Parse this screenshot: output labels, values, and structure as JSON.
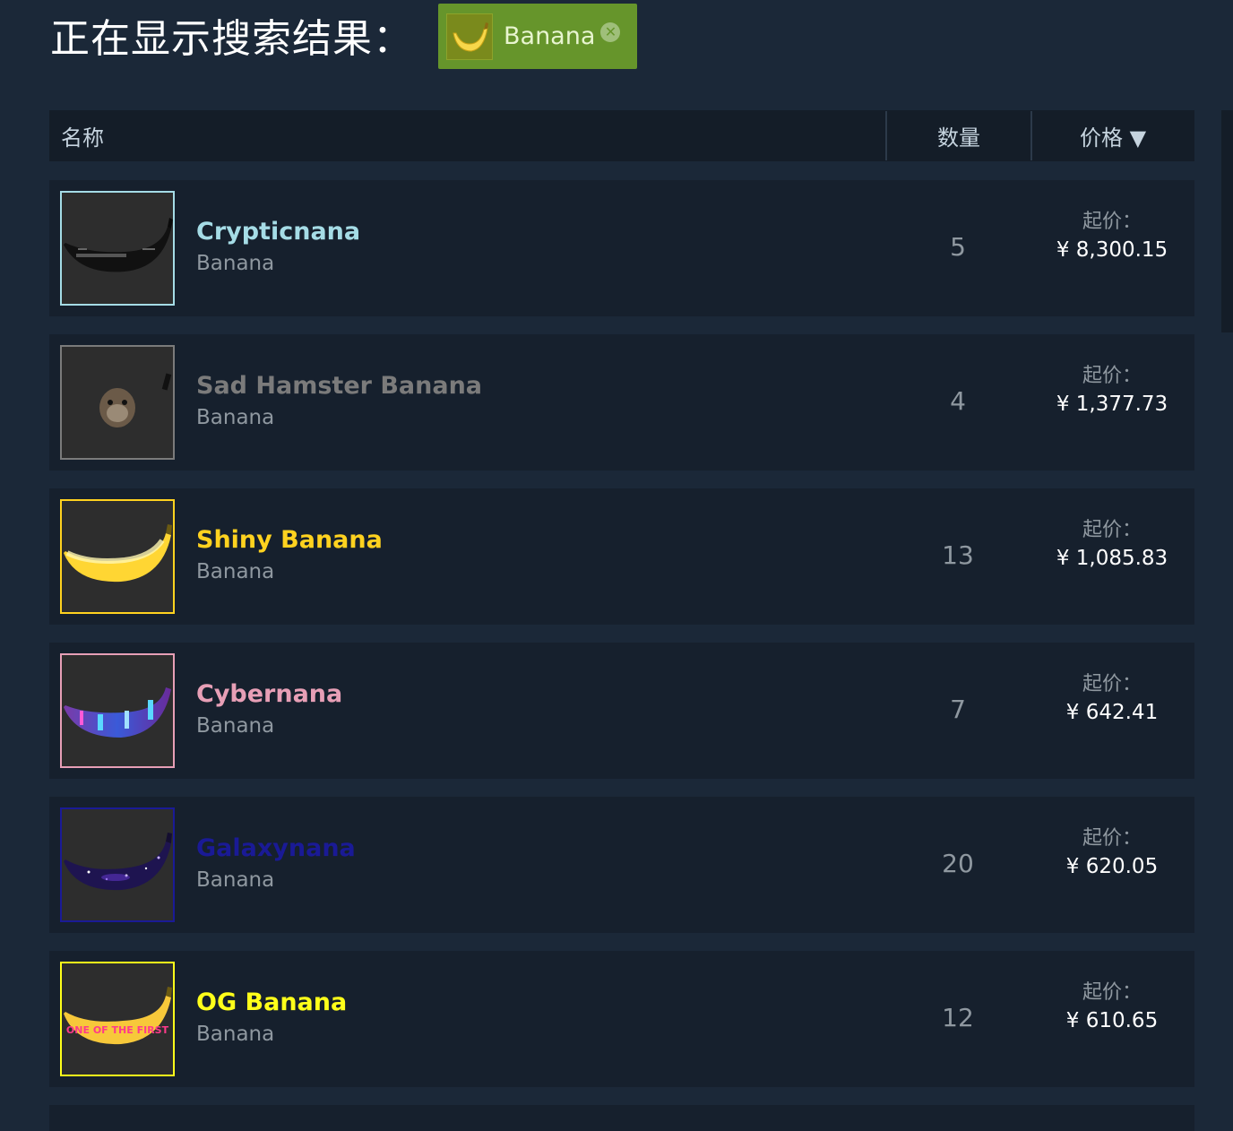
{
  "search": {
    "heading": "正在显示搜索结果：",
    "filter_chip": {
      "label": "Banana",
      "close_glyph": "✕",
      "icon": "banana-icon",
      "color": "#66952b"
    }
  },
  "table": {
    "columns": {
      "name": "名称",
      "quantity": "数量",
      "price": "价格 ▼"
    }
  },
  "items": [
    {
      "name": "Crypticnana",
      "type": "Banana",
      "quantity": "5",
      "price_label": "起价：",
      "price": "¥ 8,300.15",
      "name_color": "#a5dce6",
      "border_color": "#a5dce6",
      "thumbnail": "crypticnana-banana-icon"
    },
    {
      "name": "Sad Hamster Banana",
      "type": "Banana",
      "quantity": "4",
      "price_label": "起价：",
      "price": "¥ 1,377.73",
      "name_color": "#7b7b7b",
      "border_color": "#7b7b7b",
      "thumbnail": "sad-hamster-banana-icon"
    },
    {
      "name": "Shiny Banana",
      "type": "Banana",
      "quantity": "13",
      "price_label": "起价：",
      "price": "¥ 1,085.83",
      "name_color": "#ffd21f",
      "border_color": "#ffd21f",
      "thumbnail": "shiny-banana-icon"
    },
    {
      "name": "Cybernana",
      "type": "Banana",
      "quantity": "7",
      "price_label": "起价：",
      "price": "¥ 642.41",
      "name_color": "#e79fb6",
      "border_color": "#e79fb6",
      "thumbnail": "cybernana-banana-icon"
    },
    {
      "name": "Galaxynana",
      "type": "Banana",
      "quantity": "20",
      "price_label": "起价：",
      "price": "¥ 620.05",
      "name_color": "#1a1a96",
      "border_color": "#1a1a96",
      "thumbnail": "galaxy-banana-icon"
    },
    {
      "name": "OG Banana",
      "type": "Banana",
      "quantity": "12",
      "price_label": "起价：",
      "price": "¥ 610.65",
      "name_color": "#ffff1a",
      "border_color": "#ffff1a",
      "thumbnail": "og-banana-icon",
      "thumbnail_text": "ONE OF THE FIRST"
    }
  ]
}
